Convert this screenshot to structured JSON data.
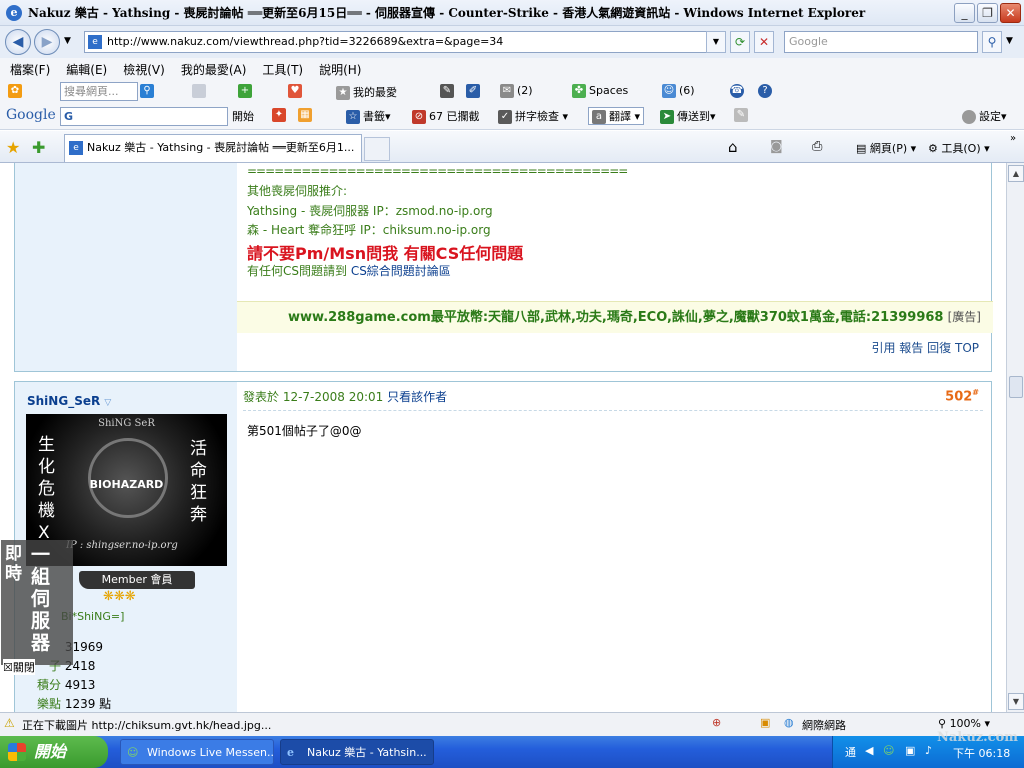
{
  "window": {
    "title": "Nakuz 樂古 - Yathsing - 喪屍討論帖 ══更新至6月15日══ - 伺服器宣傳 - Counter-Strike - 香港人氣網遊資訊站 - Windows Internet Explorer",
    "minimize": "_",
    "maximize": "❐",
    "close": "✕"
  },
  "address": {
    "url": "http://www.nakuz.com/viewthread.php?tid=3226689&extra=&page=34",
    "search_placeholder": "Google"
  },
  "menu": [
    "檔案(F)",
    "編輯(E)",
    "檢視(V)",
    "我的最愛(A)",
    "工具(T)",
    "說明(H)"
  ],
  "toolbar1": {
    "search_placeholder": "搜尋網頁...",
    "favorites": "我的最愛",
    "mail_count": "(2)",
    "spaces": "Spaces",
    "contacts_count": "(6)"
  },
  "toolbar2": {
    "google": "Google",
    "google_box": "G",
    "start": "開始",
    "bookmarks": "書籤",
    "blocked": "67 已攔截",
    "spellcheck": "拼字檢查",
    "translate": "翻譯",
    "sendto": "傳送到",
    "settings": "設定"
  },
  "tab": {
    "title": "Nakuz 樂古 - Yathsing - 喪屍討論帖 ══更新至6月1...",
    "page_menu": "網頁(P)",
    "tools_menu": "工具(O)"
  },
  "post1": {
    "separator": "==========================================",
    "recommend": "其他喪屍伺服推介:",
    "server1": "Yathsing - 喪屍伺服器 IP：zsmod.no-ip.org",
    "server2": "森 - Heart 奪命狂呼 IP：chiksum.no-ip.org",
    "warning": "請不要Pm/Msn問我 有關CS任何問題",
    "redirect_pre": "有任何CS問題請到 ",
    "redirect_link": "CS綜合問題討論區",
    "ad_text": "www.288game.com最平放幣:天龍八部,武林,功夫,瑪奇,ECO,誅仙,夢之,魔獸370蚊1萬金,電話:21399968",
    "ad_tag": "[廣告]",
    "actions": [
      "引用",
      "報告",
      "回復",
      "TOP"
    ]
  },
  "post2": {
    "author": "ShiNG_SeR",
    "posted_prefix": "發表於 12-7-2008 20:01",
    "author_only": "只看該作者",
    "floor": "502",
    "floor_mark": "#",
    "content": "第501個帖子了@0@",
    "avatar": {
      "top_text": "ShiNG SeR",
      "left_text": "生化危機X",
      "right_text": "活命狂奔",
      "center_text": "BIOHAZARD",
      "bottom_text": "IP : shingser.no-ip.org"
    },
    "rank": "Member 會員",
    "stars": "❋❋❋",
    "custom_title": "Bi*ShiNG=]",
    "stats": [
      {
        "label": "",
        "value": "31969"
      },
      {
        "label": "子",
        "value": "2418"
      },
      {
        "label": "積分",
        "value": "4913"
      },
      {
        "label": "樂點",
        "value": "1239 點"
      }
    ],
    "overlay_text_1": "一組伺服器",
    "overlay_text_2": "即時",
    "overlay_close": "關閉"
  },
  "status": {
    "text": "正在下載圖片 http://chiksum.gvt.hk/head.jpg...",
    "zone": "網際網路",
    "zoom": "100%"
  },
  "taskbar": {
    "start": "開始",
    "task1": "Windows Live Messen...",
    "task2": "Nakuz 樂古 - Yathsin...",
    "clock": "下午 06:18",
    "watermark": "Nakuz.com"
  },
  "colors": {
    "green_text": "#3a7d1a",
    "warning_red": "#d9141f",
    "floor_orange": "#e76a16",
    "link_blue": "#0b3f8f"
  }
}
